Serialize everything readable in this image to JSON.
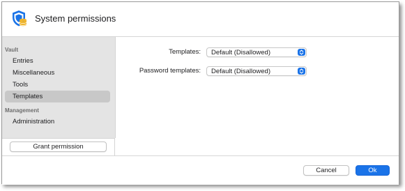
{
  "window": {
    "title": "System permissions",
    "app_icon": "shield-database-icon"
  },
  "sidebar": {
    "sections": [
      {
        "header": "Vault",
        "items": [
          {
            "label": "Entries",
            "selected": false
          },
          {
            "label": "Miscellaneous",
            "selected": false
          },
          {
            "label": "Tools",
            "selected": false
          },
          {
            "label": "Templates",
            "selected": true
          }
        ]
      },
      {
        "header": "Management",
        "items": [
          {
            "label": "Administration",
            "selected": false
          }
        ]
      }
    ],
    "grant_button": "Grant permission"
  },
  "form": {
    "rows": [
      {
        "label": "Templates:",
        "value": "Default (Disallowed)"
      },
      {
        "label": "Password templates:",
        "value": "Default (Disallowed)"
      }
    ]
  },
  "footer": {
    "cancel_label": "Cancel",
    "ok_label": "Ok"
  },
  "colors": {
    "accent": "#1a73e8",
    "sidebar_bg": "#e4e4e4",
    "selected_bg": "#c8c8c8",
    "icon_shield": "#1a73e8",
    "icon_database": "#f0b429"
  }
}
